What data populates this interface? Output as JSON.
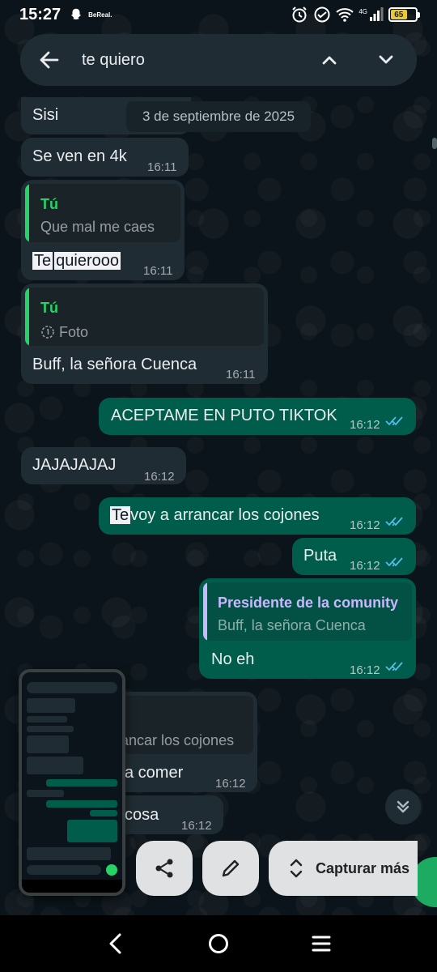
{
  "status_bar": {
    "time": "15:27",
    "app_notification": "BeReal.",
    "network": "4G",
    "battery": "65"
  },
  "search": {
    "query": "te quiero"
  },
  "date_chip": "3 de septiembre de 2025",
  "messages": [
    {
      "dir": "in",
      "text": "Sisi"
    },
    {
      "dir": "in",
      "text": "Se ven en 4k",
      "time": "16:11"
    },
    {
      "dir": "in",
      "quote_author": "Tú",
      "quote_text": "Que mal me caes",
      "text_highlight": "Te",
      "text_rest": "quierooo",
      "time": "16:11"
    },
    {
      "dir": "in",
      "quote_author": "Tú",
      "quote_text": "Foto",
      "text": "Buff, la señora Cuenca",
      "time": "16:11"
    },
    {
      "dir": "out",
      "text": "ACEPTAME EN PUTO TIKTOK",
      "time": "16:12"
    },
    {
      "dir": "in",
      "text": "JAJAJAJAJ",
      "time": "16:12"
    },
    {
      "dir": "out",
      "text_highlight": "Te",
      "text_rest": "voy a arrancar los cojones",
      "time": "16:12"
    },
    {
      "dir": "out",
      "text": "Puta",
      "time": "16:12"
    },
    {
      "dir": "out",
      "quote_author": "Presidente de la comunity",
      "quote_text": "Buff, la señora Cuenca",
      "text": "No eh",
      "time": "16:12"
    },
    {
      "dir": "in",
      "quote_text": "ancar los cojones",
      "text": "a comer",
      "time": "16:12"
    },
    {
      "dir": "in",
      "text": "cosa",
      "time": "16:12"
    }
  ],
  "screenshot_tools": {
    "capture_more_label": "Capturar más"
  },
  "colors": {
    "incoming_bubble": "#202c33",
    "outgoing_bubble": "#005c4b",
    "accent_green": "#25d366",
    "quote_out_author": "#c9b7ff",
    "ticks": "#53bdeb"
  }
}
